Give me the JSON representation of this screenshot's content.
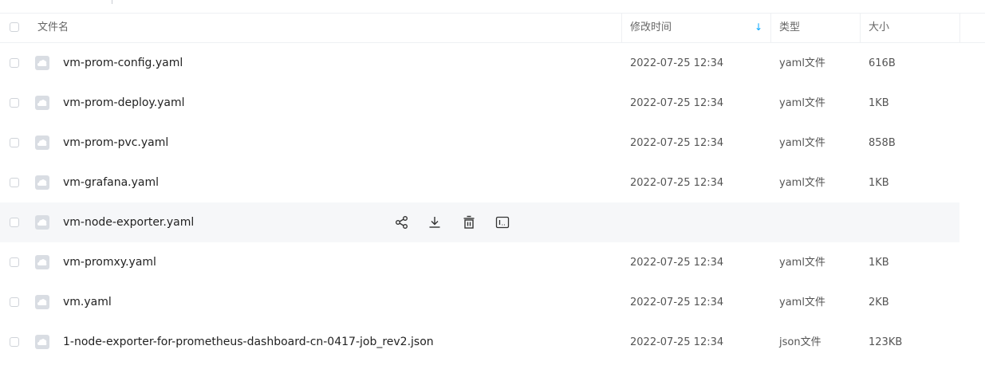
{
  "header": {
    "name_col": "文件名",
    "time_col": "修改时间",
    "type_col": "类型",
    "size_col": "大小",
    "sort_arrow": "↓"
  },
  "files": [
    {
      "name": "vm-prom-config.yaml",
      "time": "2022-07-25 12:34",
      "type": "yaml文件",
      "size": "616B"
    },
    {
      "name": "vm-prom-deploy.yaml",
      "time": "2022-07-25 12:34",
      "type": "yaml文件",
      "size": "1KB"
    },
    {
      "name": "vm-prom-pvc.yaml",
      "time": "2022-07-25 12:34",
      "type": "yaml文件",
      "size": "858B"
    },
    {
      "name": "vm-grafana.yaml",
      "time": "2022-07-25 12:34",
      "type": "yaml文件",
      "size": "1KB"
    },
    {
      "name": "vm-node-exporter.yaml",
      "hovered": true,
      "actions": [
        "share-icon",
        "download-icon",
        "delete-icon",
        "terminal-icon"
      ]
    },
    {
      "name": "vm-promxy.yaml",
      "time": "2022-07-25 12:34",
      "type": "yaml文件",
      "size": "1KB"
    },
    {
      "name": "vm.yaml",
      "time": "2022-07-25 12:34",
      "type": "yaml文件",
      "size": "2KB"
    },
    {
      "name": "1-node-exporter-for-prometheus-dashboard-cn-0417-job_rev2.json",
      "time": "2022-07-25 12:34",
      "type": "json文件",
      "size": "123KB"
    }
  ],
  "colors": {
    "accent": "#06a7ff",
    "hover_row": "#f6f7f9",
    "file_icon": "#d9dde3"
  }
}
